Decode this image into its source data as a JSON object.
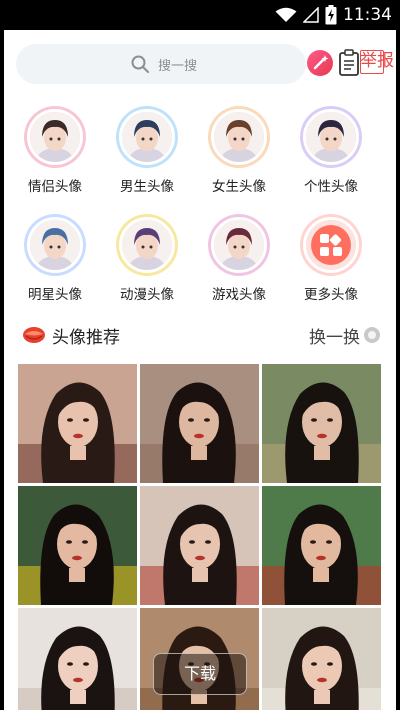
{
  "status_bar": {
    "time": "11:34",
    "icons": [
      "wifi-icon",
      "signal-icon",
      "battery-charging-icon"
    ]
  },
  "search": {
    "placeholder": "搜一搜"
  },
  "header_actions": {
    "report_label": "举报",
    "icons": [
      "magic-wand-icon",
      "clipboard-icon"
    ]
  },
  "categories": [
    {
      "label": "情侣头像",
      "ring": "#f7c6d2"
    },
    {
      "label": "男生头像",
      "ring": "#bfe2fb"
    },
    {
      "label": "女生头像",
      "ring": "#fbd9bb"
    },
    {
      "label": "个性头像",
      "ring": "#d9cdf7"
    },
    {
      "label": "明星头像",
      "ring": "#c7dcff"
    },
    {
      "label": "动漫头像",
      "ring": "#f7e79f"
    },
    {
      "label": "游戏头像",
      "ring": "#f2c4e4"
    },
    {
      "label": "更多头像",
      "ring": "#ffd4d0"
    }
  ],
  "recommend": {
    "title": "头像推荐",
    "refresh_label": "换一换"
  },
  "photos": [
    {
      "name": "portrait-1",
      "bg": "#c9a493",
      "hair": "#2a1a16",
      "skin": "#e8c2ad",
      "accent": "#6a3a2f"
    },
    {
      "name": "portrait-2",
      "bg": "#a88f7f",
      "hair": "#1b1210",
      "skin": "#ddb7a0",
      "accent": "#8a6a5a"
    },
    {
      "name": "portrait-3",
      "bg": "#7a8a62",
      "hair": "#18120f",
      "skin": "#e1bda8",
      "accent": "#b9a67a"
    },
    {
      "name": "portrait-4",
      "bg": "#3c5a3a",
      "hair": "#120d0b",
      "skin": "#e3b9a2",
      "accent": "#e8c31a"
    },
    {
      "name": "portrait-5",
      "bg": "#d6c4b9",
      "hair": "#1d1412",
      "skin": "#e6c4b0",
      "accent": "#b03a2e"
    },
    {
      "name": "portrait-6",
      "bg": "#4f7a4a",
      "hair": "#15100d",
      "skin": "#e2b99e",
      "accent": "#c4322a"
    },
    {
      "name": "portrait-7",
      "bg": "#e7e2dd",
      "hair": "#1a1311",
      "skin": "#efcfbf",
      "accent": "#c9b9ad"
    },
    {
      "name": "portrait-8",
      "bg": "#b08a6c",
      "hair": "#2b1a12",
      "skin": "#e5c1a6",
      "accent": "#7a5335"
    },
    {
      "name": "portrait-9",
      "bg": "#d7d0c4",
      "hair": "#221613",
      "skin": "#ebc9b5",
      "accent": "#f0ece4"
    }
  ],
  "download_label": "下载"
}
